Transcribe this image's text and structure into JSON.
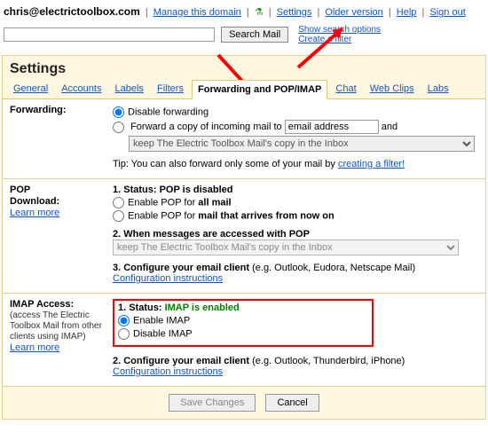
{
  "top": {
    "email": "chris@electrictoolbox.com",
    "manage": "Manage this domain",
    "settings": "Settings",
    "older": "Older version",
    "help": "Help",
    "signout": "Sign out"
  },
  "search": {
    "button": "Search Mail",
    "opts": "Show search options",
    "filter": "Create a filter"
  },
  "heading": "Settings",
  "tabs": {
    "general": "General",
    "accounts": "Accounts",
    "labels": "Labels",
    "filters": "Filters",
    "pop": "Forwarding and POP/IMAP",
    "chat": "Chat",
    "webclips": "Web Clips",
    "labs": "Labs"
  },
  "fwd": {
    "label": "Forwarding:",
    "disable": "Disable forwarding",
    "forward_pre": "Forward a copy of incoming mail to",
    "addr": "email address",
    "and": "and",
    "keep": "keep The Electric Toolbox Mail's copy in the Inbox",
    "tip_pre": "Tip: You can also forward only some of your mail by ",
    "tip_link": "creating a filter!"
  },
  "pop": {
    "label1": "POP",
    "label2": "Download:",
    "learn": "Learn more",
    "status_pre": "1. Status: ",
    "status": "POP is disabled",
    "enable_all_pre": "Enable POP for ",
    "enable_all_b": "all mail",
    "enable_now_pre": "Enable POP for ",
    "enable_now_b": "mail that arrives from now on",
    "step2": "2. When messages are accessed with POP",
    "select": "keep The Electric Toolbox Mail's copy in the Inbox",
    "step3_b": "3. Configure your email client",
    "step3_t": " (e.g. Outlook, Eudora, Netscape Mail)",
    "config": "Configuration instructions"
  },
  "imap": {
    "label": "IMAP Access:",
    "sub": "(access The Electric Toolbox Mail from other clients using IMAP)",
    "learn": "Learn more",
    "status_pre": "1. Status: ",
    "status": "IMAP is enabled",
    "enable": "Enable IMAP",
    "disable": "Disable IMAP",
    "step2_b": "2. Configure your email client",
    "step2_t": " (e.g. Outlook, Thunderbird, iPhone)",
    "config": "Configuration instructions"
  },
  "footer": {
    "save": "Save Changes",
    "cancel": "Cancel"
  }
}
